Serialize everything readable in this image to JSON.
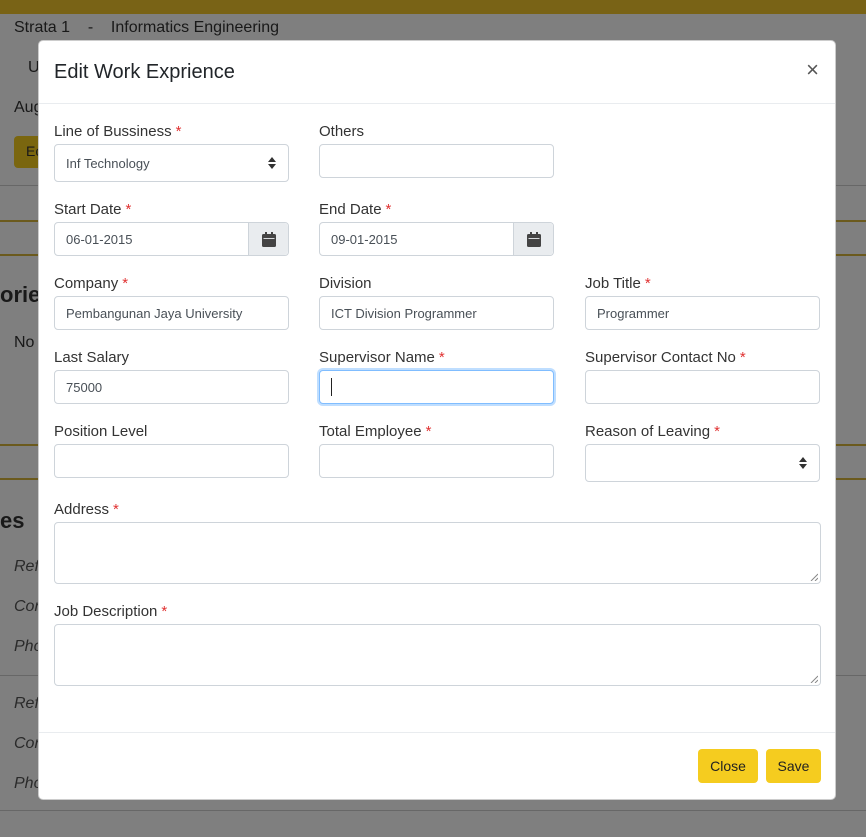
{
  "background": {
    "program_line": "Strata 1    -    Informatics Engineering",
    "frag_u": "U",
    "frag_aug": "Aug",
    "frag_ec": "Ec",
    "frag_orie": "orie",
    "frag_no": "No",
    "frag_es": "es",
    "frag_ref1": "Refe",
    "frag_con1": "Con",
    "frag_pho1": "Pho",
    "frag_ref2": "Refe",
    "frag_con2": "Con",
    "frag_pho2": "Pho"
  },
  "modal": {
    "title": "Edit Work Exprience",
    "close_symbol": "×",
    "required_mark": "*",
    "fields": {
      "line_of_business": {
        "label": "Line of Bussiness",
        "value": "Inf Technology"
      },
      "others": {
        "label": "Others",
        "value": ""
      },
      "start_date": {
        "label": "Start Date",
        "value": "06-01-2015"
      },
      "end_date": {
        "label": "End Date",
        "value": "09-01-2015"
      },
      "company": {
        "label": "Company",
        "value": "Pembangunan Jaya University"
      },
      "division": {
        "label": "Division",
        "value": "ICT Division Programmer"
      },
      "job_title": {
        "label": "Job Title",
        "value": "Programmer"
      },
      "last_salary": {
        "label": "Last Salary",
        "value": "75000"
      },
      "supervisor_name": {
        "label": "Supervisor Name",
        "value": ""
      },
      "supervisor_contact": {
        "label": "Supervisor Contact No",
        "value": ""
      },
      "position_level": {
        "label": "Position Level",
        "value": ""
      },
      "total_employee": {
        "label": "Total Employee",
        "value": ""
      },
      "reason_of_leaving": {
        "label": "Reason of Leaving",
        "value": ""
      },
      "address": {
        "label": "Address",
        "value": ""
      },
      "job_description": {
        "label": "Job Description",
        "value": ""
      }
    },
    "footer": {
      "close_label": "Close",
      "save_label": "Save"
    }
  },
  "colors": {
    "accent": "#f5cc1f",
    "required": "#e03131",
    "focus": "#80bdff"
  },
  "icons": {
    "calendar": "calendar-icon",
    "select": "select-arrows-icon",
    "close": "close-icon"
  }
}
